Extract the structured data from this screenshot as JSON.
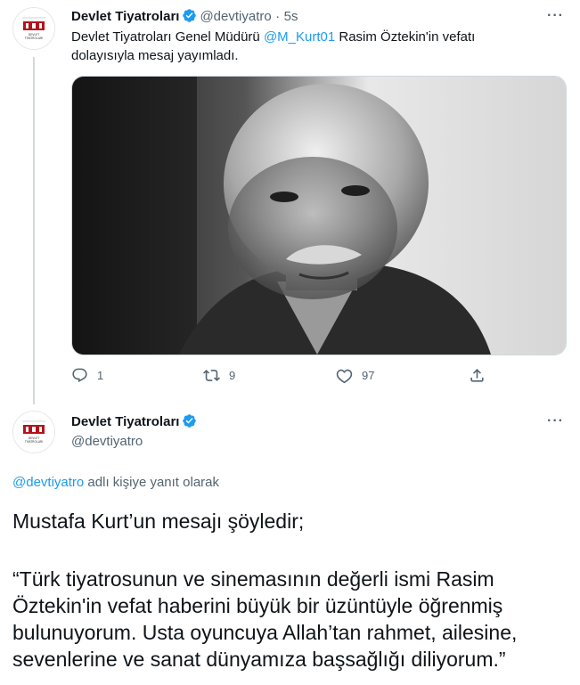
{
  "tweet1": {
    "name": "Devlet Tiyatroları",
    "handle": "@devtiyatro",
    "sep": "·",
    "time": "5s",
    "more": "···",
    "text_before": "Devlet Tiyatroları Genel Müdürü ",
    "mention": "@M_Kurt01",
    "text_after_line1": " Rasim Öztekin'in vefatı",
    "text_line2": "dolayısıyla mesaj yayımladı.",
    "replies": "1",
    "retweets": "9",
    "likes": "97",
    "logo_text": "DEVLET TİYATROLARI"
  },
  "tweet2": {
    "name": "Devlet Tiyatroları",
    "handle": "@devtiyatro",
    "more": "···",
    "reply_mention": "@devtiyatro",
    "reply_suffix": " adlı kişiye yanıt olarak",
    "line1": "Mustafa Kurt’un mesajı şöyledir;",
    "quote1": "“Türk tiyatrosunun ve sinemasının değerli ismi Rasim",
    "quote2": "Öztekin'in vefat haberini büyük bir üzüntüyle öğrenmiş",
    "quote3": "bulunuyorum. Usta oyuncuya Allah’tan rahmet, ailesine,",
    "quote4": "sevenlerine ve sanat dünyamıza başsağlığı diliyorum.”"
  },
  "colors": {
    "accent": "#1d9bf0",
    "text": "#0f1419",
    "muted": "#536471",
    "logo_red": "#b5121b"
  },
  "icons": [
    "verified-badge-icon",
    "reply-icon",
    "retweet-icon",
    "like-icon",
    "share-icon",
    "more-icon"
  ]
}
